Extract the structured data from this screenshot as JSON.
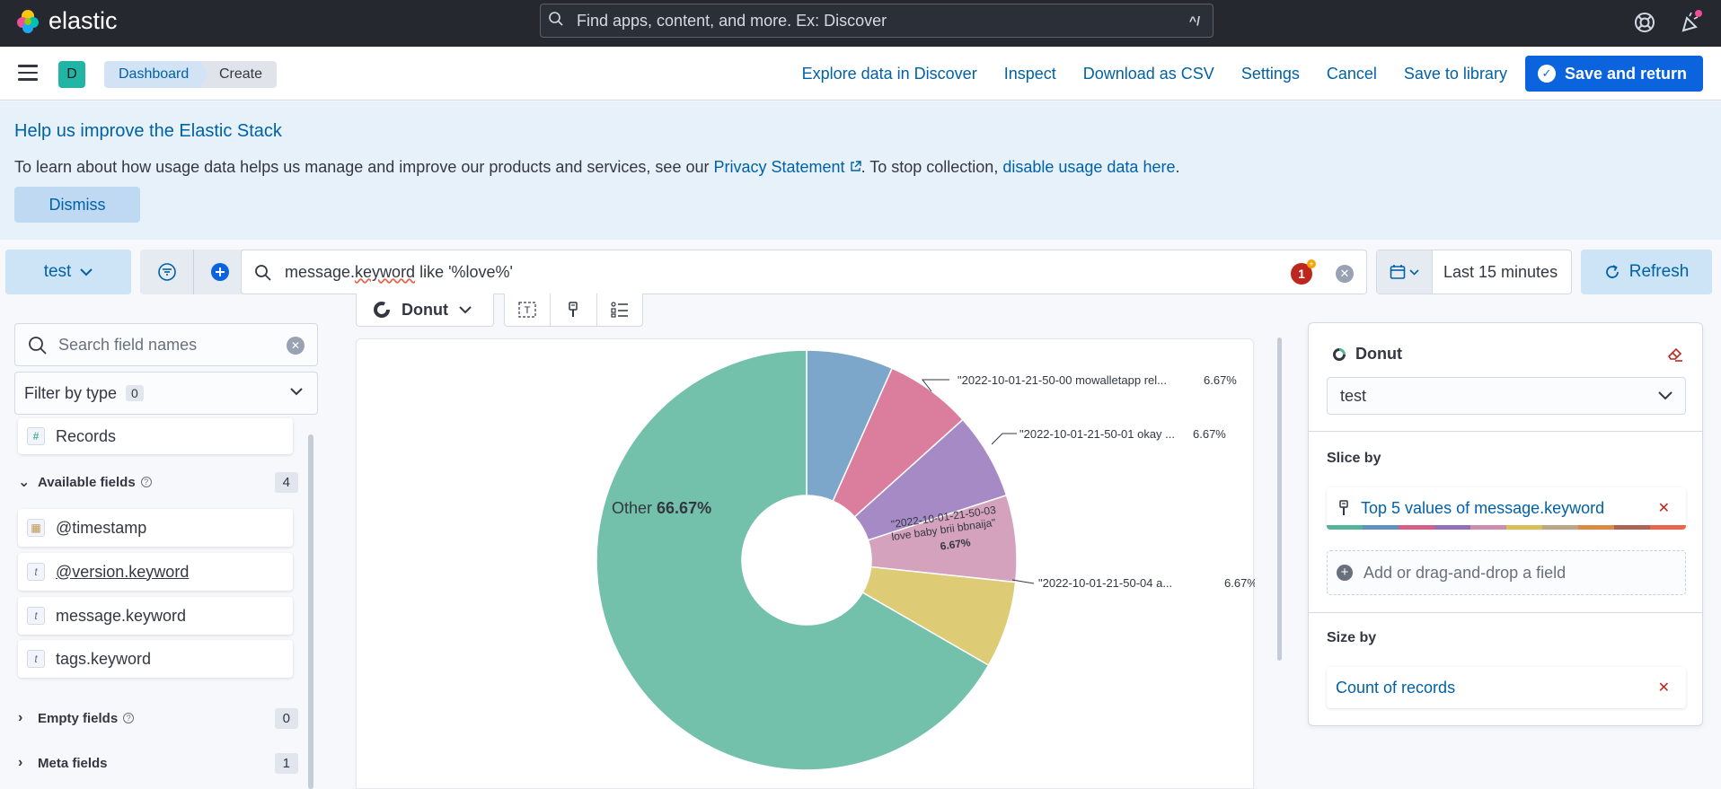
{
  "header": {
    "brand": "elastic",
    "search_placeholder": "Find apps, content, and more. Ex: Discover",
    "search_shortcut": "^/"
  },
  "appbar": {
    "space_initial": "D",
    "breadcrumbs": [
      "Dashboard",
      "Create"
    ],
    "links": [
      "Explore data in Discover",
      "Inspect",
      "Download as CSV",
      "Settings",
      "Cancel",
      "Save to library"
    ],
    "primary": "Save and return"
  },
  "callout": {
    "title": "Help us improve the Elastic Stack",
    "text_before": "To learn about how usage data helps us manage and improve our products and services, see our ",
    "privacy_link": "Privacy Statement",
    "text_middle": ". To stop collection, ",
    "disable_link": "disable usage data here",
    "text_after": ".",
    "dismiss": "Dismiss"
  },
  "query": {
    "data_view": "test",
    "query_prefix": "message.",
    "query_underlined": "keyword",
    "query_suffix": " like '%love%'",
    "notification_count": "1",
    "time_range": "Last 15 minutes",
    "refresh": "Refresh"
  },
  "sidebar": {
    "search_placeholder": "Search field names",
    "filter_label": "Filter by type",
    "filter_count": "0",
    "records": "Records",
    "available_label": "Available fields",
    "available_count": "4",
    "fields": [
      "@timestamp",
      "@version.keyword",
      "message.keyword",
      "tags.keyword"
    ],
    "empty_label": "Empty fields",
    "empty_count": "0",
    "meta_label": "Meta fields",
    "meta_count": "1"
  },
  "workspace": {
    "chart_type": "Donut"
  },
  "chart_data": {
    "type": "pie",
    "subtype": "donut",
    "slices": [
      {
        "label": "\"2022-10-01-21-50-03 love baby brii bbnaija\"",
        "value": 6.67,
        "color": "#6092c0"
      },
      {
        "label": "\"2022-10-01-21-50-00 mowalletapp rel...",
        "value": 6.67,
        "color": "#d36086"
      },
      {
        "label": "\"2022-10-01-21-50-01 okay ...",
        "value": 6.67,
        "color": "#9170b8"
      },
      {
        "label": "\"2022-10-01-21-50-03 love baby brii bbnaija\"",
        "value": 6.67,
        "color": "#ca8eae"
      },
      {
        "label": "\"2022-10-01-21-50-04 a...",
        "value": 6.67,
        "color": "#d6bf57"
      },
      {
        "label": "Other",
        "value": 66.67,
        "color": "#54b399"
      }
    ],
    "inside_label_line1": "\"2022-10-01-21-50-03",
    "inside_label_line2": "love baby brii bbnaija\"",
    "other_label": "Other",
    "other_pct": "66.67%",
    "callouts": [
      {
        "text": "\"2022-10-01-21-50-00 mowalletapp rel...",
        "pct": "6.67%"
      },
      {
        "text": "\"2022-10-01-21-50-01 okay ...",
        "pct": "6.67%"
      },
      {
        "text": "6.67%"
      },
      {
        "text": "\"2022-10-01-21-50-04 a...",
        "pct": "6.67%"
      }
    ]
  },
  "config": {
    "chart_label": "Donut",
    "layer": "test",
    "slice_by": "Slice by",
    "slice_value": "Top 5 values of message.keyword",
    "add_field": "Add or drag-and-drop a field",
    "size_by": "Size by",
    "size_value": "Count of records",
    "palette": [
      "#54b399",
      "#6092c0",
      "#d36086",
      "#9170b8",
      "#ca8eae",
      "#d6bf57",
      "#b9a888",
      "#da8b45",
      "#aa6556",
      "#e7664c"
    ]
  }
}
